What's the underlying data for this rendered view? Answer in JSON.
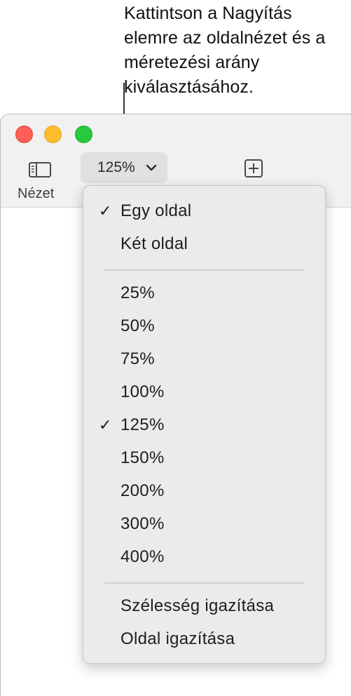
{
  "callout": {
    "text": "Kattintson a Nagyítás elemre az oldalnézet és a méretezési arány kiválasztásához."
  },
  "window": {
    "traffic_lights": {
      "close_color": "#fe5f57",
      "minimize_color": "#febc2e",
      "zoom_color": "#28c840"
    },
    "toolbar": {
      "view_label": "Nézet",
      "view_icon": "sidebar-icon",
      "zoom_value": "125%",
      "zoom_icon": "chevron-down-icon",
      "add_icon": "plus-square-icon"
    }
  },
  "zoom_menu": {
    "page_items": [
      {
        "label": "Egy oldal",
        "checked": true
      },
      {
        "label": "Két oldal",
        "checked": false
      }
    ],
    "zoom_items": [
      {
        "label": "25%",
        "checked": false
      },
      {
        "label": "50%",
        "checked": false
      },
      {
        "label": "75%",
        "checked": false
      },
      {
        "label": "100%",
        "checked": false
      },
      {
        "label": "125%",
        "checked": true
      },
      {
        "label": "150%",
        "checked": false
      },
      {
        "label": "200%",
        "checked": false
      },
      {
        "label": "300%",
        "checked": false
      },
      {
        "label": "400%",
        "checked": false
      }
    ],
    "fit_items": [
      {
        "label": "Szélesség igazítása"
      },
      {
        "label": "Oldal igazítása"
      }
    ],
    "check_glyph": "✓"
  }
}
